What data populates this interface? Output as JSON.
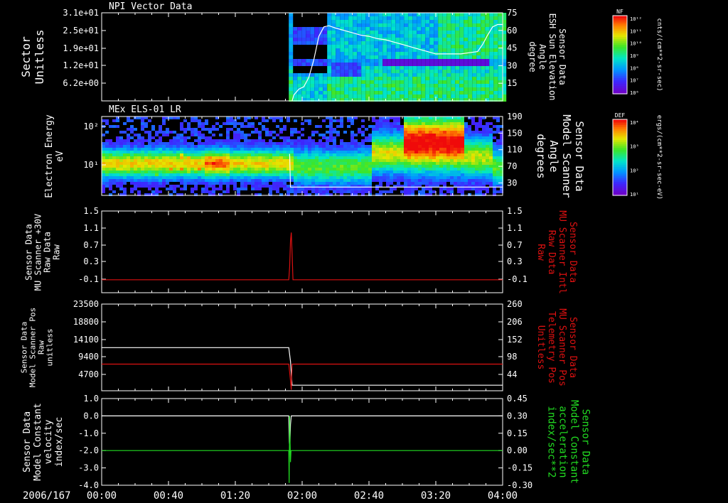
{
  "date_label": "2006/167",
  "x_axis": {
    "ticks": [
      "00:00",
      "00:40",
      "01:20",
      "02:00",
      "02:40",
      "03:20",
      "04:00"
    ],
    "range_min": [
      0,
      240
    ]
  },
  "colors": {
    "background": "#000000",
    "axis": "#ffffff",
    "red_trace": "#dd1111",
    "green_trace": "#22dd22"
  },
  "chart_data": [
    {
      "type": "heatmap",
      "title": "NPI Vector Data",
      "ylabel_left": [
        "Sector",
        "Unitless"
      ],
      "ylabel_right": [
        "Sensor Data",
        "ESH Sun Elevation",
        "Angle",
        "degree"
      ],
      "yticks_left": [
        "3.1e+01",
        "2.5e+01",
        "1.9e+01",
        "1.2e+01",
        "6.2e+00"
      ],
      "ylim_right": [
        0,
        75
      ],
      "yticks_right": [
        75,
        60,
        45,
        30,
        15
      ],
      "colorbar": {
        "label": "NF",
        "units": "cnts/(cm**2-sr-sec)",
        "ticks": [
          "10¹²",
          "10¹¹",
          "10¹⁰",
          "10⁹",
          "10⁸",
          "10⁷",
          "10⁶"
        ]
      },
      "line_series": {
        "name": "ESH Sun Elevation Angle",
        "x": [
          0,
          114,
          115,
          118,
          121,
          124,
          127,
          130,
          133,
          136,
          140,
          145,
          150,
          155,
          160,
          165,
          170,
          175,
          180,
          185,
          190,
          195,
          200,
          205,
          210,
          215,
          220,
          225,
          228,
          231,
          234,
          237,
          240
        ],
        "y": [
          null,
          0,
          5,
          10,
          12,
          20,
          35,
          55,
          63,
          64,
          62,
          60,
          58,
          56,
          55,
          53,
          52,
          50,
          48,
          46,
          44,
          42,
          40,
          40,
          40,
          40,
          41,
          42,
          48,
          56,
          63,
          65,
          65
        ]
      }
    },
    {
      "type": "heatmap",
      "title": "MEx ELS-01 LR",
      "ylabel_left": [
        "Electron Energy",
        "eV"
      ],
      "ylabel_right": [
        "Sensor Data",
        "Model Scanner",
        "Angle",
        "degrees"
      ],
      "yticks_left": [
        "10²",
        "10¹"
      ],
      "ylim_right": [
        0,
        190
      ],
      "yticks_right": [
        190,
        150,
        110,
        70,
        30
      ],
      "colorbar": {
        "label": "DEF",
        "units": "ergs/(cm**2-sr-sec-eV)",
        "ticks": [
          "10⁴",
          "10³",
          "10²",
          "10¹"
        ]
      },
      "line_series": {
        "name": "Model Scanner Angle",
        "x": [
          0,
          112,
          112.5,
          113,
          240
        ],
        "y": [
          null,
          null,
          100,
          20,
          20
        ]
      }
    },
    {
      "type": "line",
      "ylabel_left": [
        "Sensor Data",
        "MU Scanner +30V",
        "Raw Data",
        "Raw"
      ],
      "ylabel_right": [
        "Sensor Data",
        "MU Scanner Intl",
        "Raw Data",
        "Raw"
      ],
      "ylim": [
        -0.4,
        1.5
      ],
      "yticks_left": [
        "1.5",
        "1.1",
        "0.7",
        "0.3",
        "-0.1"
      ],
      "yticks_right": [
        "1.5",
        "1.1",
        "0.7",
        "0.3",
        "-0.1"
      ],
      "series": [
        {
          "color": "red",
          "x": [
            0,
            112,
            112.5,
            113,
            113.5,
            114,
            114.5,
            240
          ],
          "y": [
            -0.1,
            -0.1,
            0.2,
            0.8,
            1.0,
            0.5,
            -0.1,
            -0.1
          ]
        }
      ]
    },
    {
      "type": "line",
      "ylabel_left": [
        "Sensor Data",
        "Model Scanner Pos",
        "Raw",
        "unitless"
      ],
      "ylabel_right": [
        "Sensor Data",
        "MU Scanner Pos",
        "Telemetry Pos",
        "Unitless"
      ],
      "ylim_left": [
        0,
        23500
      ],
      "ylim_right": [
        0,
        260
      ],
      "yticks_left": [
        "23500",
        "18800",
        "14100",
        "9400",
        "4700"
      ],
      "yticks_right": [
        "260",
        "206",
        "152",
        "98",
        "44"
      ],
      "series": [
        {
          "color": "white",
          "axis": "left",
          "x": [
            0,
            112,
            113,
            114,
            240
          ],
          "y": [
            11700,
            11700,
            8000,
            1500,
            1500
          ]
        },
        {
          "color": "red",
          "axis": "right",
          "x": [
            0,
            112,
            112.5,
            113,
            113.5,
            114,
            240
          ],
          "y": [
            80,
            80,
            55,
            30,
            3,
            80,
            80
          ]
        }
      ]
    },
    {
      "type": "line",
      "ylabel_left": [
        "Sensor Data",
        "Model Constant",
        "velocity",
        "index/sec"
      ],
      "ylabel_right": [
        "Sensor Data",
        "Model Constant",
        "acceleration",
        "index/sec**2"
      ],
      "ylim_left": [
        -4.0,
        1.0
      ],
      "ylim_right": [
        -0.3,
        0.45
      ],
      "yticks_left": [
        "1.0",
        "0.0",
        "-1.0",
        "-2.0",
        "-3.0",
        "-4.0"
      ],
      "yticks_right": [
        "0.45",
        "0.30",
        "0.15",
        "0.00",
        "-0.15",
        "-0.30"
      ],
      "series": [
        {
          "color": "white",
          "axis": "left",
          "x": [
            0,
            112,
            112.3,
            112.6,
            113,
            113.5,
            240
          ],
          "y": [
            0.0,
            0.0,
            -1.5,
            -2.0,
            -0.5,
            0.0,
            0.0
          ]
        },
        {
          "color": "green",
          "axis": "right",
          "x": [
            0,
            112,
            112.2,
            112.5,
            112.8,
            113,
            113.3,
            240
          ],
          "y": [
            0.0,
            0.0,
            -0.28,
            0.3,
            0.05,
            -0.1,
            0.0,
            0.0
          ]
        }
      ]
    }
  ]
}
